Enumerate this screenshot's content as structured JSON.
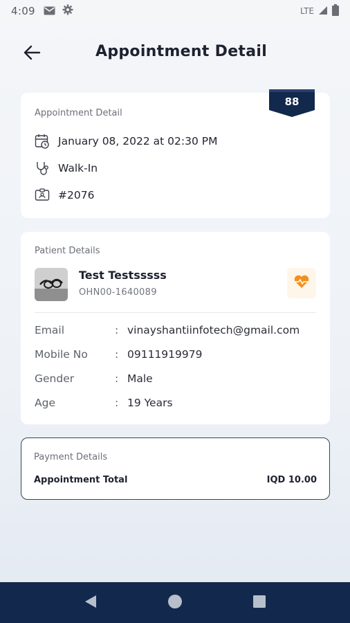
{
  "status_bar": {
    "time": "4:09",
    "network": "LTE",
    "icons": [
      "mail-icon",
      "settings-icon",
      "signal-icon",
      "battery-icon"
    ]
  },
  "header": {
    "title": "Appointment Detail",
    "back_icon": "arrow-left-icon"
  },
  "appointment": {
    "section_label": "Appointment Detail",
    "badge_number": "88",
    "date_time": "January 08, 2022 at 02:30 PM",
    "type": "Walk-In",
    "id": "#2076"
  },
  "patient": {
    "section_label": "Patient Details",
    "name": "Test Testsssss",
    "patient_id": "OHN00-1640089",
    "rows": [
      {
        "key": "Email",
        "value": "vinayshantiinfotech@gmail.com"
      },
      {
        "key": "Mobile No",
        "value": "09111919979"
      },
      {
        "key": "Gender",
        "value": "Male"
      },
      {
        "key": "Age",
        "value": "19 Years"
      }
    ],
    "separator": ":"
  },
  "payment": {
    "section_label": "Payment Details",
    "total_label": "Appointment Total",
    "total_value": "IQD 10.00"
  },
  "colors": {
    "navy": "#12284c",
    "accent_orange": "#f2901e",
    "card_bg": "#ffffff"
  }
}
